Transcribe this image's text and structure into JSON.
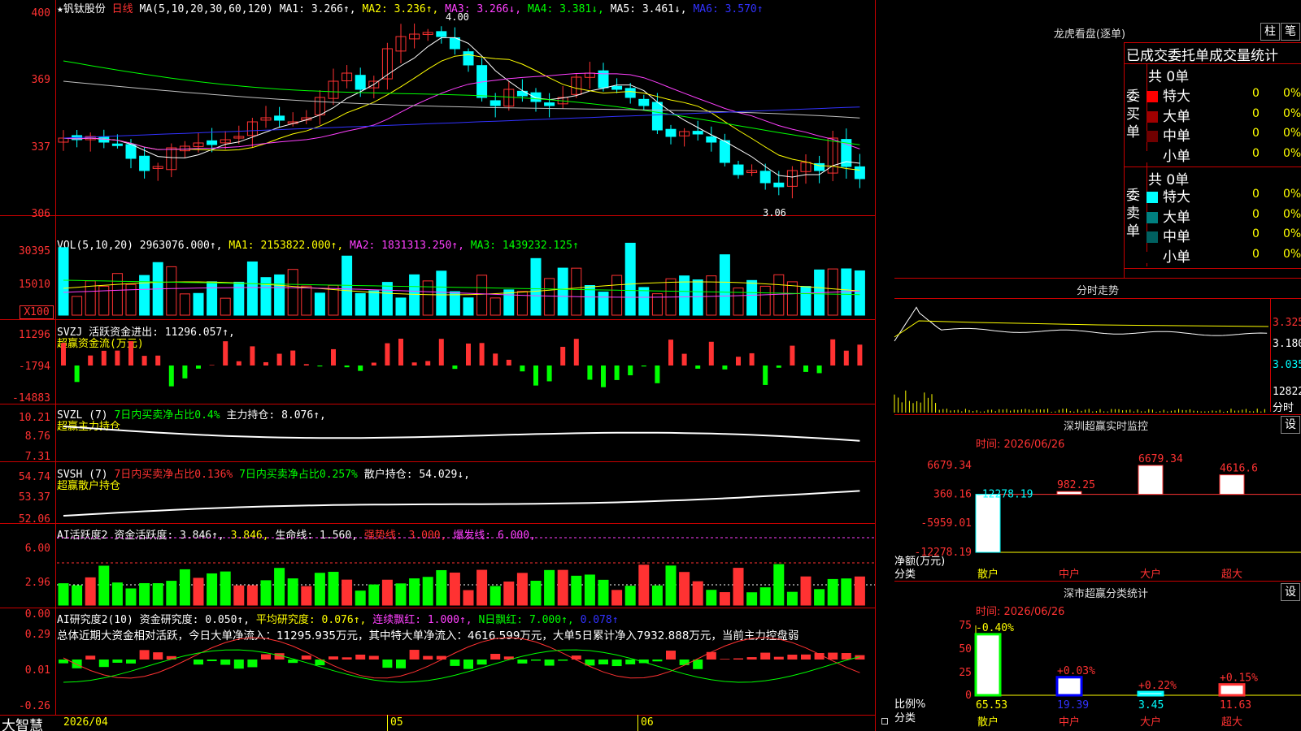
{
  "app": {
    "name": "大智慧"
  },
  "stock": {
    "star": "★",
    "name": "钒钛股份",
    "period": "日线"
  },
  "main_chart": {
    "ma_label": "MA(5,10,20,30,60,120)",
    "ma1": "MA1: 3.266↑,",
    "ma2": "MA2: 3.236↑,",
    "ma3": "MA3: 3.266↓,",
    "ma4": "MA4: 3.381↓,",
    "ma5": "MA5: 3.461↓,",
    "ma6": "MA6: 3.570↑",
    "high_marker": "4.00",
    "low_marker": "3.06",
    "y_ticks": [
      "400",
      "369",
      "337",
      "306"
    ]
  },
  "vol_panel": {
    "label": "VOL(5,10,20)",
    "value": "2963076.000↑,",
    "ma1": "MA1: 2153822.000↑,",
    "ma2": "MA2: 1831313.250↑,",
    "ma3": "MA3: 1439232.125↑",
    "y_ticks": [
      "30395",
      "15010",
      "X100"
    ]
  },
  "svzj_panel": {
    "label": "SVZJ",
    "active_label": "活跃资金进出: 11296.057↑,",
    "sub": "超赢资金流(万元)",
    "y_ticks": [
      "11296",
      "-1794",
      "-14883"
    ]
  },
  "svzl_panel": {
    "label": "SVZL (7)",
    "ratio": "7日内买卖净占比0.4%",
    "hold": "主力持仓: 8.076↑,",
    "sub": "超赢主力持仓",
    "y_ticks": [
      "10.21",
      "8.76",
      "7.31"
    ]
  },
  "svsh_panel": {
    "label": "SVSH (7)",
    "ratio1": "7日内买卖净占比0.136%",
    "ratio2": "7日内买卖净占比0.257%",
    "hold": "散户持仓: 54.029↓,",
    "sub": "超赢散户持仓",
    "y_ticks": [
      "54.74",
      "53.37",
      "52.06"
    ]
  },
  "ai_active_panel": {
    "label": "AI活跃度2",
    "active": "资金活跃度: 3.846↑,",
    "val2": "3.846,",
    "life": "生命线: 1.560,",
    "strong": "强势线: 3.000,",
    "burst": "爆发线: 6.000,",
    "y_ticks": [
      "6.00",
      "2.96",
      "0.00"
    ]
  },
  "ai_research_panel": {
    "label": "AI研究度2(10)",
    "research": "资金研究度: 0.050↑,",
    "avg": "平均研究度: 0.076↑,",
    "streak": "连续飘红: 1.000↑,",
    "nday": "N日飘红: 7.000↑,",
    "last": "0.078↑",
    "summary": "总体近期大资金相对活跃，今日大单净流入：11295.935万元，其中特大单净流入：4616.599万元，大单5日累计净入7932.888万元，当前主力控盘弱",
    "y_ticks": [
      "0.29",
      "0.01",
      "-0.26"
    ]
  },
  "x_axis": {
    "start": "2026/04",
    "m05": "05",
    "m06": "06"
  },
  "longhu": {
    "title": "龙虎看盘(逐单)",
    "btn1": "柱",
    "btn2": "笔",
    "header": "已成交委托单成交量统计",
    "buy_label": "委买单",
    "sell_label": "委卖单",
    "buy_total": "共 0单",
    "sell_total": "共 0单",
    "buy_rows": [
      {
        "label": "特大",
        "count": "0",
        "pct": "0%",
        "color": "#ff0000"
      },
      {
        "label": "大单",
        "count": "0",
        "pct": "0%",
        "color": "#a00000"
      },
      {
        "label": "中单",
        "count": "0",
        "pct": "0%",
        "color": "#700000"
      },
      {
        "label": "小单",
        "count": "0",
        "pct": "0%",
        "color": "#000000"
      }
    ],
    "sell_rows": [
      {
        "label": "特大",
        "count": "0",
        "pct": "0%",
        "color": "#00ffff"
      },
      {
        "label": "大单",
        "count": "0",
        "pct": "0%",
        "color": "#008080"
      },
      {
        "label": "中单",
        "count": "0",
        "pct": "0%",
        "color": "#006060"
      },
      {
        "label": "小单",
        "count": "0",
        "pct": "0%",
        "color": "#000000"
      }
    ]
  },
  "fenshi": {
    "title": "分时走势",
    "p1": "3.325",
    "p2": "3.180",
    "p3": "3.035",
    "vol": "12822",
    "unit": "分时"
  },
  "sz_monitor": {
    "title": "深圳超赢实时监控",
    "set_btn": "设",
    "time": "时间: 2026/06/26",
    "y_ticks": [
      "6679.34",
      "360.16",
      "-5959.01",
      "-12278.19"
    ],
    "y_unit": "净额(万元)",
    "x_unit": "分类",
    "categories": [
      "散户",
      "中户",
      "大户",
      "超大"
    ],
    "values": [
      -12278.19,
      982.25,
      6679.34,
      4616.6
    ],
    "value_labels": [
      "-12278.19",
      "982.25",
      "6679.34",
      "4616.6"
    ]
  },
  "sz_class": {
    "title": "深市超赢分类统计",
    "set_btn": "设",
    "time": "时间: 2026/06/26",
    "y_ticks": [
      "75",
      "50",
      "25",
      "0"
    ],
    "y_unit": "比例%",
    "x_unit": "分类",
    "categories": [
      "散户",
      "中户",
      "大户",
      "超大"
    ],
    "values": [
      65.53,
      19.39,
      3.45,
      11.63
    ],
    "value_labels": [
      "65.53",
      "19.39",
      "3.45",
      "11.63"
    ],
    "deltas": [
      "-0.40%",
      "+0.03%",
      "+0.22%",
      "+0.15%"
    ]
  },
  "colors": {
    "up": "#ff3232",
    "down": "#00ffff",
    "grid": "#c80000"
  }
}
